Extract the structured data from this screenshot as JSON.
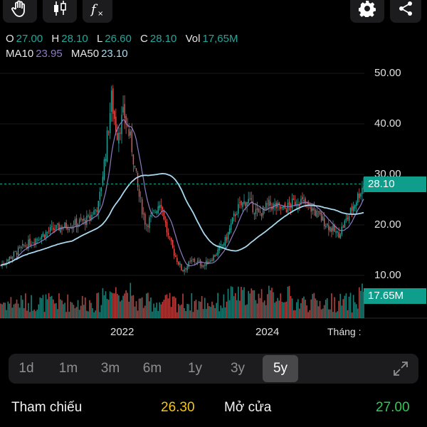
{
  "legend": {
    "o_label": "O",
    "o_value": "27.00",
    "h_label": "H",
    "h_value": "28.10",
    "l_label": "L",
    "l_value": "26.60",
    "c_label": "C",
    "c_value": "28.10",
    "vol_label": "Vol",
    "vol_value": "17,65M",
    "ma10_label": "MA10",
    "ma10_value": "23.95",
    "ma50_label": "MA50",
    "ma50_value": "23.10"
  },
  "colors": {
    "up": "#26a69a",
    "down": "#ef5350",
    "ma10": "#8e7cc3",
    "ma50": "#a9d8ef",
    "accent": "#0f9d8c",
    "reference": "#f5c518",
    "open_green": "#34c759"
  },
  "y_axis": [
    "50.00",
    "40.00",
    "30.00",
    "20.00",
    "10.00"
  ],
  "price_tag": "28.10",
  "volume_tag": "17.65M",
  "x_axis": {
    "label_2022": "2022",
    "label_2024": "2024",
    "unit_label": "Tháng :"
  },
  "chart_data": {
    "type": "candlestick",
    "ylim": [
      0,
      52
    ],
    "y_ticks": [
      50,
      40,
      30,
      20,
      10
    ],
    "last_price": 28.1,
    "close_path": [
      {
        "t": 0,
        "p": 12
      },
      {
        "t": 0.05,
        "p": 15
      },
      {
        "t": 0.09,
        "p": 17
      },
      {
        "t": 0.14,
        "p": 19
      },
      {
        "t": 0.19,
        "p": 20
      },
      {
        "t": 0.24,
        "p": 21
      },
      {
        "t": 0.27,
        "p": 24
      },
      {
        "t": 0.29,
        "p": 35
      },
      {
        "t": 0.305,
        "p": 45
      },
      {
        "t": 0.32,
        "p": 38
      },
      {
        "t": 0.34,
        "p": 42
      },
      {
        "t": 0.36,
        "p": 36
      },
      {
        "t": 0.38,
        "p": 26
      },
      {
        "t": 0.4,
        "p": 20
      },
      {
        "t": 0.42,
        "p": 22
      },
      {
        "t": 0.44,
        "p": 25
      },
      {
        "t": 0.46,
        "p": 18
      },
      {
        "t": 0.48,
        "p": 14
      },
      {
        "t": 0.5,
        "p": 11
      },
      {
        "t": 0.53,
        "p": 13
      },
      {
        "t": 0.56,
        "p": 12
      },
      {
        "t": 0.59,
        "p": 14
      },
      {
        "t": 0.62,
        "p": 17
      },
      {
        "t": 0.65,
        "p": 23
      },
      {
        "t": 0.68,
        "p": 25
      },
      {
        "t": 0.71,
        "p": 22
      },
      {
        "t": 0.74,
        "p": 24
      },
      {
        "t": 0.78,
        "p": 23
      },
      {
        "t": 0.82,
        "p": 25
      },
      {
        "t": 0.86,
        "p": 23
      },
      {
        "t": 0.9,
        "p": 20
      },
      {
        "t": 0.93,
        "p": 18
      },
      {
        "t": 0.96,
        "p": 22
      },
      {
        "t": 1.0,
        "p": 28.1
      }
    ]
  },
  "timeframes": [
    "1d",
    "1m",
    "3m",
    "6m",
    "1y",
    "3y",
    "5y"
  ],
  "active_timeframe": "5y",
  "bottom": {
    "ref_label": "Tham chiếu",
    "ref_value": "26.30",
    "open_label": "Mở cửa",
    "open_value": "27.00"
  }
}
